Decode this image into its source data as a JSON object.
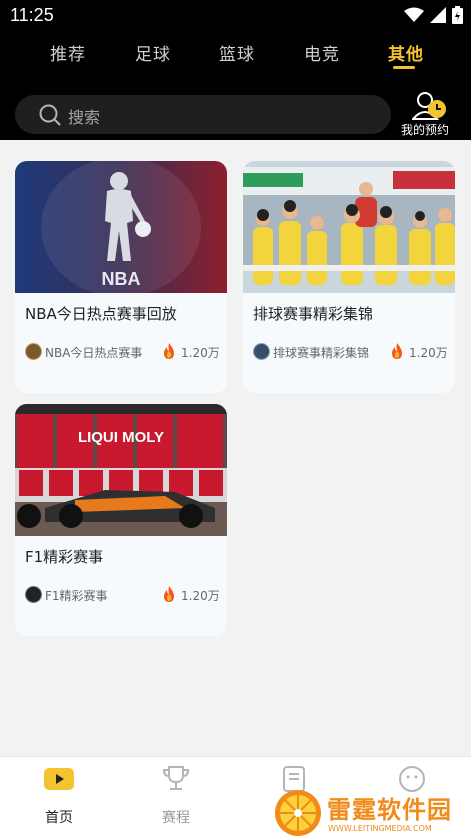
{
  "status_bar": {
    "time": "11:25"
  },
  "tabs": [
    {
      "label": "推荐",
      "active": false
    },
    {
      "label": "足球",
      "active": false
    },
    {
      "label": "篮球",
      "active": false
    },
    {
      "label": "电竞",
      "active": false
    },
    {
      "label": "其他",
      "active": true
    }
  ],
  "search": {
    "placeholder": "搜索"
  },
  "reservation": {
    "label": "我的预约"
  },
  "cards": [
    {
      "title": "NBA今日热点赛事回放",
      "author": "NBA今日热点赛事",
      "views": "1.20万",
      "thumb_text": "NBA"
    },
    {
      "title": "排球赛事精彩集锦",
      "author": "排球赛事精彩集锦",
      "views": "1.20万"
    },
    {
      "title": "F1精彩赛事",
      "author": "F1精彩赛事",
      "views": "1.20万",
      "thumb_text": "LIQUI MOLY"
    }
  ],
  "bottom_nav": [
    {
      "label": "首页",
      "icon": "home-play-icon",
      "active": true
    },
    {
      "label": "赛程",
      "icon": "trophy-icon",
      "active": false
    },
    {
      "label": "",
      "icon": "document-icon",
      "active": false
    },
    {
      "label": "",
      "icon": "face-icon",
      "active": false
    }
  ],
  "watermark": {
    "title": "雷霆软件园",
    "url": "WWW.LEITINGMEDIA.COM"
  },
  "colors": {
    "accent": "#f4c430",
    "background": "#f2f2f2",
    "topbar": "#000000"
  }
}
